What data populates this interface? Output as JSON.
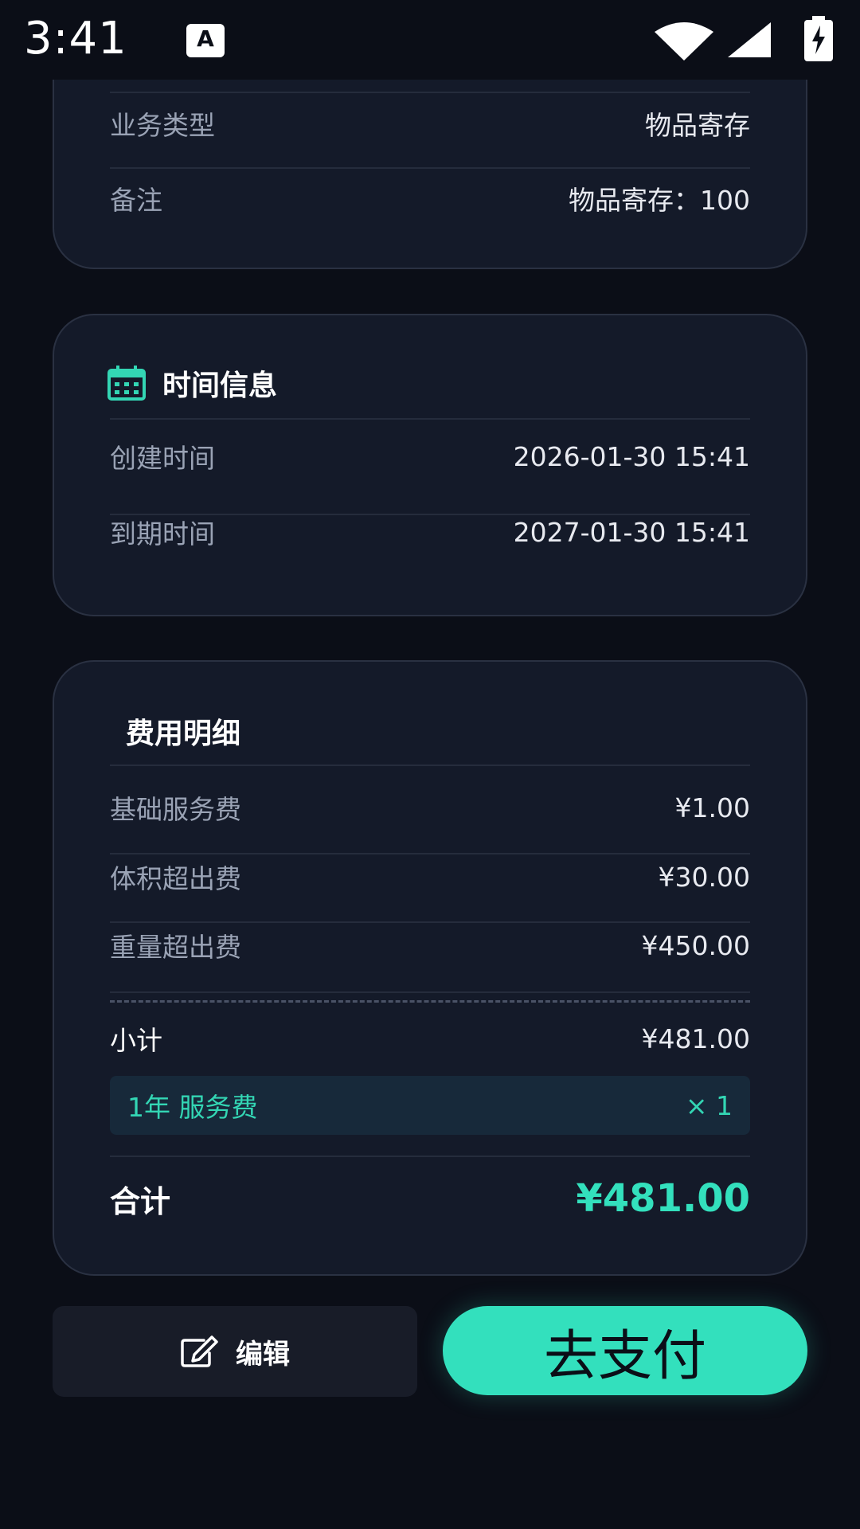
{
  "status_bar": {
    "time": "3:41",
    "app_icon_letter": "A"
  },
  "info_card": {
    "rows": [
      {
        "label": "业务类型",
        "value": "物品寄存"
      },
      {
        "label": "备注",
        "value": "物品寄存：100"
      }
    ]
  },
  "time_card": {
    "title": "时间信息",
    "icon": "calendar-icon",
    "rows": [
      {
        "label": "创建时间",
        "value": "2026-01-30 15:41"
      },
      {
        "label": "到期时间",
        "value": "2027-01-30 15:41"
      }
    ]
  },
  "fee_card": {
    "title": "费用明细",
    "rows": [
      {
        "label": "基础服务费",
        "value": "¥1.00"
      },
      {
        "label": "体积超出费",
        "value": "¥30.00"
      },
      {
        "label": "重量超出费",
        "value": "¥450.00"
      }
    ],
    "subtotal_label": "小计",
    "subtotal_value": "¥481.00",
    "service_tag_label": "1年 服务费",
    "service_tag_qty": "× 1",
    "total_label": "合计",
    "total_value": "¥481.00"
  },
  "actions": {
    "edit_label": "编辑",
    "pay_label": "去支付"
  },
  "colors": {
    "background": "#0b0e17",
    "card": "#141a29",
    "accent": "#33e0bd"
  }
}
